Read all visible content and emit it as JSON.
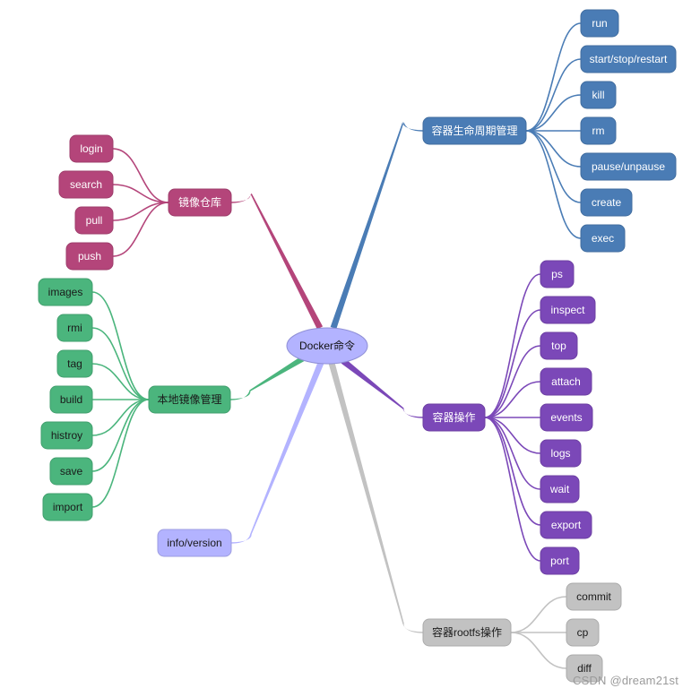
{
  "root": {
    "label": "Docker命令",
    "fill": "#b3b3ff",
    "stroke": "#8f8fd6",
    "text_color": "#111111"
  },
  "branches": [
    {
      "id": "lifecycle",
      "label": "容器生命周期管理",
      "color": "#4a7cb5",
      "text_color": "#ffffff",
      "children": [
        "run",
        "start/stop/restart",
        "kill",
        "rm",
        "pause/unpause",
        "create",
        "exec"
      ]
    },
    {
      "id": "registry",
      "label": "镜像仓库",
      "color": "#b4457a",
      "text_color": "#ffffff",
      "children": [
        "login",
        "search",
        "pull",
        "push"
      ]
    },
    {
      "id": "local-images",
      "label": "本地镜像管理",
      "color": "#4bb57d",
      "text_color": "#1a1a1a",
      "children": [
        "images",
        "rmi",
        "tag",
        "build",
        "histroy",
        "save",
        "import"
      ]
    },
    {
      "id": "info",
      "label": "info/version",
      "color": "#b3b3ff",
      "text_color": "#1a1a1a",
      "children": []
    },
    {
      "id": "container-ops",
      "label": "容器操作",
      "color": "#7b48b8",
      "text_color": "#ffffff",
      "children": [
        "ps",
        "inspect",
        "top",
        "attach",
        "events",
        "logs",
        "wait",
        "export",
        "port"
      ]
    },
    {
      "id": "rootfs",
      "label": "容器rootfs操作",
      "color": "#c2c2c2",
      "text_color": "#1a1a1a",
      "children": [
        "commit",
        "cp",
        "diff"
      ]
    }
  ],
  "watermark": "CSDN @dream21st"
}
